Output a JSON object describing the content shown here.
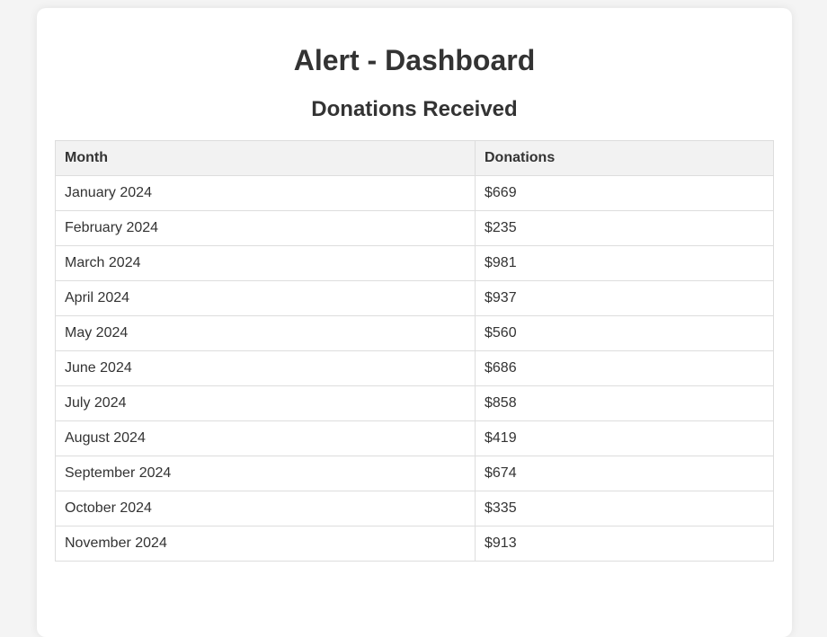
{
  "header": {
    "title": "Alert - Dashboard"
  },
  "section": {
    "title": "Donations Received"
  },
  "table": {
    "columns": [
      "Month",
      "Donations"
    ],
    "rows": [
      {
        "month": "January 2024",
        "donations": "$669"
      },
      {
        "month": "February 2024",
        "donations": "$235"
      },
      {
        "month": "March 2024",
        "donations": "$981"
      },
      {
        "month": "April 2024",
        "donations": "$937"
      },
      {
        "month": "May 2024",
        "donations": "$560"
      },
      {
        "month": "June 2024",
        "donations": "$686"
      },
      {
        "month": "July 2024",
        "donations": "$858"
      },
      {
        "month": "August 2024",
        "donations": "$419"
      },
      {
        "month": "September 2024",
        "donations": "$674"
      },
      {
        "month": "October 2024",
        "donations": "$335"
      },
      {
        "month": "November 2024",
        "donations": "$913"
      }
    ]
  },
  "colors": {
    "page_background": "#f4f4f4",
    "card_background": "#ffffff",
    "header_row_background": "#f2f2f2",
    "border": "#dddddd",
    "text": "#333333"
  }
}
